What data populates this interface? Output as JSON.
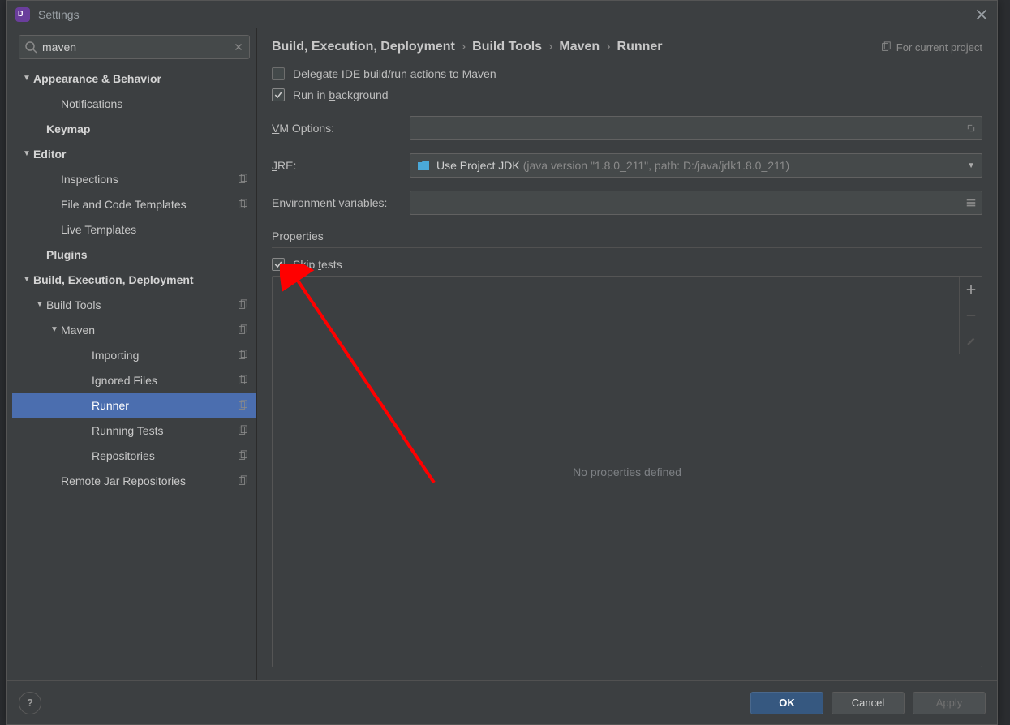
{
  "window": {
    "title": "Settings"
  },
  "search": {
    "value": "maven"
  },
  "tree": {
    "items": [
      {
        "indent": 0,
        "label": "Appearance & Behavior",
        "expandable": true,
        "bold": true
      },
      {
        "indent": 2,
        "label": "Notifications"
      },
      {
        "indent": 1,
        "label": "Keymap",
        "bold": true
      },
      {
        "indent": 0,
        "label": "Editor",
        "expandable": true,
        "bold": true
      },
      {
        "indent": 2,
        "label": "Inspections",
        "copy": true
      },
      {
        "indent": 2,
        "label": "File and Code Templates",
        "copy": true
      },
      {
        "indent": 2,
        "label": "Live Templates"
      },
      {
        "indent": 1,
        "label": "Plugins",
        "bold": true
      },
      {
        "indent": 0,
        "label": "Build, Execution, Deployment",
        "expandable": true,
        "bold": true
      },
      {
        "indent": 1,
        "label": "Build Tools",
        "expandable": true,
        "copy": true
      },
      {
        "indent": 2,
        "label": "Maven",
        "expandable": true,
        "copy": true
      },
      {
        "indent": 4,
        "label": "Importing",
        "copy": true
      },
      {
        "indent": 4,
        "label": "Ignored Files",
        "copy": true
      },
      {
        "indent": 4,
        "label": "Runner",
        "copy": true,
        "selected": true
      },
      {
        "indent": 4,
        "label": "Running Tests",
        "copy": true
      },
      {
        "indent": 4,
        "label": "Repositories",
        "copy": true
      },
      {
        "indent": 2,
        "label": "Remote Jar Repositories",
        "copy": true
      }
    ]
  },
  "breadcrumb": [
    "Build, Execution, Deployment",
    "Build Tools",
    "Maven",
    "Runner"
  ],
  "scope_label": "For current project",
  "checks": {
    "delegate": {
      "label_pre": "Delegate IDE build/run actions to ",
      "label_mnemonic": "M",
      "label_post": "aven",
      "checked": false
    },
    "background": {
      "label_pre": "Run in ",
      "label_mnemonic": "b",
      "label_post": "ackground",
      "checked": true
    },
    "skip_tests": {
      "label_pre": "Skip ",
      "label_mnemonic": "t",
      "label_post": "ests",
      "checked": true
    }
  },
  "rows": {
    "vm": {
      "label_mnemonic": "V",
      "label_post": "M Options:"
    },
    "jre": {
      "label_mnemonic": "J",
      "label_post": "RE:",
      "value": "Use Project JDK",
      "muted": "(java version \"1.8.0_211\", path: D:/java/jdk1.8.0_211)"
    },
    "env": {
      "label_mnemonic": "E",
      "label_post": "nvironment variables:"
    }
  },
  "properties": {
    "title": "Properties",
    "empty_text": "No properties defined"
  },
  "footer": {
    "ok": "OK",
    "cancel": "Cancel",
    "apply": "Apply"
  }
}
